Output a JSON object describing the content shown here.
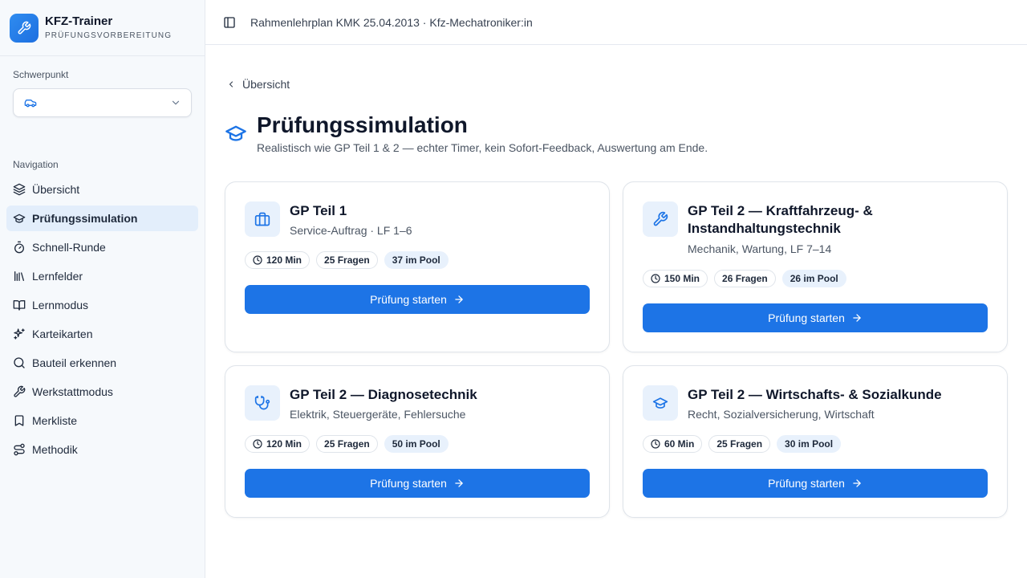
{
  "brand": {
    "title": "KFZ-Trainer",
    "subtitle": "PRÜFUNGSVORBEREITUNG"
  },
  "focus": {
    "label": "Schwerpunkt",
    "selected_icon": "car-icon"
  },
  "navigation": {
    "label": "Navigation",
    "items": [
      {
        "label": "Übersicht",
        "icon": "layers-icon",
        "active": false
      },
      {
        "label": "Prüfungssimulation",
        "icon": "graduation-cap-icon",
        "active": true
      },
      {
        "label": "Schnell-Runde",
        "icon": "timer-icon",
        "active": false
      },
      {
        "label": "Lernfelder",
        "icon": "library-icon",
        "active": false
      },
      {
        "label": "Lernmodus",
        "icon": "book-open-icon",
        "active": false
      },
      {
        "label": "Karteikarten",
        "icon": "sparkles-icon",
        "active": false
      },
      {
        "label": "Bauteil erkennen",
        "icon": "search-icon",
        "active": false
      },
      {
        "label": "Werkstattmodus",
        "icon": "wrench-icon",
        "active": false
      },
      {
        "label": "Merkliste",
        "icon": "bookmark-icon",
        "active": false
      },
      {
        "label": "Methodik",
        "icon": "route-icon",
        "active": false
      }
    ]
  },
  "topbar": {
    "context": "Rahmenlehrplan KMK 25.04.2013 · Kfz-Mechatroniker:in"
  },
  "main": {
    "back_label": "Übersicht",
    "title": "Prüfungssimulation",
    "subtitle": "Realistisch wie GP Teil 1 & 2 — echter Timer, kein Sofort-Feedback, Auswertung am Ende.",
    "cards": [
      {
        "title": "GP Teil 1",
        "subtitle": "Service-Auftrag · LF 1–6",
        "duration": "120 Min",
        "questions": "25 Fragen",
        "pool": "37 im Pool",
        "button": "Prüfung starten",
        "icon": "briefcase-icon"
      },
      {
        "title": "GP Teil 2 — Kraftfahrzeug- & Instandhaltungstechnik",
        "subtitle": "Mechanik, Wartung, LF 7–14",
        "duration": "150 Min",
        "questions": "26 Fragen",
        "pool": "26 im Pool",
        "button": "Prüfung starten",
        "icon": "wrench-icon"
      },
      {
        "title": "GP Teil 2 — Diagnosetechnik",
        "subtitle": "Elektrik, Steuergeräte, Fehlersuche",
        "duration": "120 Min",
        "questions": "25 Fragen",
        "pool": "50 im Pool",
        "button": "Prüfung starten",
        "icon": "stethoscope-icon"
      },
      {
        "title": "GP Teil 2 — Wirtschafts- & Sozialkunde",
        "subtitle": "Recht, Sozialversicherung, Wirtschaft",
        "duration": "60 Min",
        "questions": "25 Fragen",
        "pool": "30 im Pool",
        "button": "Prüfung starten",
        "icon": "graduation-cap-icon"
      }
    ]
  },
  "colors": {
    "accent": "#1d74e6",
    "active_nav": "#e3eefb",
    "icon_bg": "#e8f1fc"
  }
}
